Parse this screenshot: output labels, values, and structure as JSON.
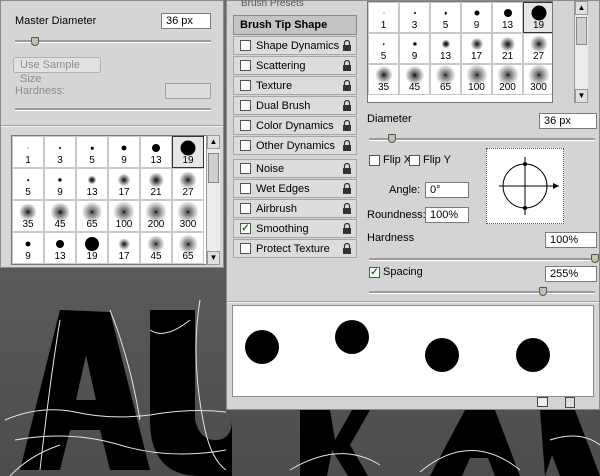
{
  "left_panel": {
    "master_diameter_label": "Master Diameter",
    "master_diameter_value": "36 px",
    "master_diameter_level": 0.1,
    "use_sample_size_label": "Use Sample Size",
    "hardness_label": "Hardness:",
    "grid": [
      [
        {
          "n": "1",
          "s": 1,
          "h": 1
        },
        {
          "n": "3",
          "s": 2,
          "h": 1
        },
        {
          "n": "5",
          "s": 2.5,
          "h": 1
        },
        {
          "n": "9",
          "s": 5,
          "h": 1
        },
        {
          "n": "13",
          "s": 8,
          "h": 1
        },
        {
          "n": "19",
          "s": 15,
          "h": 1,
          "sel": true
        }
      ],
      [
        {
          "n": "5",
          "s": 2,
          "h": 0.5
        },
        {
          "n": "9",
          "s": 4,
          "h": 0.5
        },
        {
          "n": "13",
          "s": 7,
          "h": 0.4
        },
        {
          "n": "17",
          "s": 10,
          "h": 0.3
        },
        {
          "n": "21",
          "s": 12,
          "h": 0.3
        },
        {
          "n": "27",
          "s": 14,
          "h": 0.25
        }
      ],
      [
        {
          "n": "35",
          "s": 14,
          "h": 0.25
        },
        {
          "n": "45",
          "s": 15,
          "h": 0.25
        },
        {
          "n": "65",
          "s": 16,
          "h": 0.2
        },
        {
          "n": "100",
          "s": 17,
          "h": 0.2
        },
        {
          "n": "200",
          "s": 17,
          "h": 0.2
        },
        {
          "n": "300",
          "s": 17,
          "h": 0.2
        }
      ],
      [
        {
          "n": "9",
          "s": 5,
          "h": 1
        },
        {
          "n": "13",
          "s": 8,
          "h": 1
        },
        {
          "n": "19",
          "s": 14,
          "h": 1
        },
        {
          "n": "17",
          "s": 9,
          "h": 0.3
        },
        {
          "n": "45",
          "s": 14,
          "h": 0.2
        },
        {
          "n": "65",
          "s": 15,
          "h": 0.2
        }
      ]
    ]
  },
  "right_panel": {
    "brush_presets_label": "Brush Presets",
    "brush_tip_shape_label": "Brush Tip Shape",
    "options": [
      {
        "label": "Shape Dynamics",
        "checked": false
      },
      {
        "label": "Scattering",
        "checked": false
      },
      {
        "label": "Texture",
        "checked": false
      },
      {
        "label": "Dual Brush",
        "checked": false
      },
      {
        "label": "Color Dynamics",
        "checked": false
      },
      {
        "label": "Other Dynamics",
        "checked": false
      },
      {
        "label": "Noise",
        "checked": false
      },
      {
        "label": "Wet Edges",
        "checked": false
      },
      {
        "label": "Airbrush",
        "checked": false
      },
      {
        "label": "Smoothing",
        "checked": true
      },
      {
        "label": "Protect Texture",
        "checked": false
      }
    ],
    "thumb_grid": [
      [
        {
          "n": "1",
          "s": 1,
          "h": 1
        },
        {
          "n": "3",
          "s": 2,
          "h": 1
        },
        {
          "n": "5",
          "s": 2.5,
          "h": 1
        },
        {
          "n": "9",
          "s": 5,
          "h": 1
        },
        {
          "n": "13",
          "s": 8,
          "h": 1
        },
        {
          "n": "19",
          "s": 15,
          "h": 1,
          "sel": true
        }
      ],
      [
        {
          "n": "5",
          "s": 2,
          "h": 0.5
        },
        {
          "n": "9",
          "s": 4,
          "h": 0.5
        },
        {
          "n": "13",
          "s": 7,
          "h": 0.4
        },
        {
          "n": "17",
          "s": 10,
          "h": 0.3
        },
        {
          "n": "21",
          "s": 12,
          "h": 0.3
        },
        {
          "n": "27",
          "s": 14,
          "h": 0.25
        }
      ],
      [
        {
          "n": "35",
          "s": 14,
          "h": 0.25
        },
        {
          "n": "45",
          "s": 15,
          "h": 0.25
        },
        {
          "n": "65",
          "s": 16,
          "h": 0.2
        },
        {
          "n": "100",
          "s": 17,
          "h": 0.2
        },
        {
          "n": "200",
          "s": 17,
          "h": 0.2
        },
        {
          "n": "300",
          "s": 17,
          "h": 0.2
        }
      ]
    ],
    "diameter_label": "Diameter",
    "diameter_value": "36 px",
    "diameter_level": 0.1,
    "flip_x_label": "Flip X",
    "flip_y_label": "Flip Y",
    "angle_label": "Angle:",
    "angle_value": "0°",
    "roundness_label": "Roundness:",
    "roundness_value": "100%",
    "hardness_label": "Hardness",
    "hardness_value": "100%",
    "hardness_level": 1.0,
    "spacing_label": "Spacing",
    "spacing_checked": true,
    "spacing_value": "255%",
    "spacing_level": 0.77
  },
  "canvas": {
    "text": "AURA"
  },
  "colors": {
    "check_green": "#0a7d0a",
    "panel_grey": "#d4d4d4"
  }
}
